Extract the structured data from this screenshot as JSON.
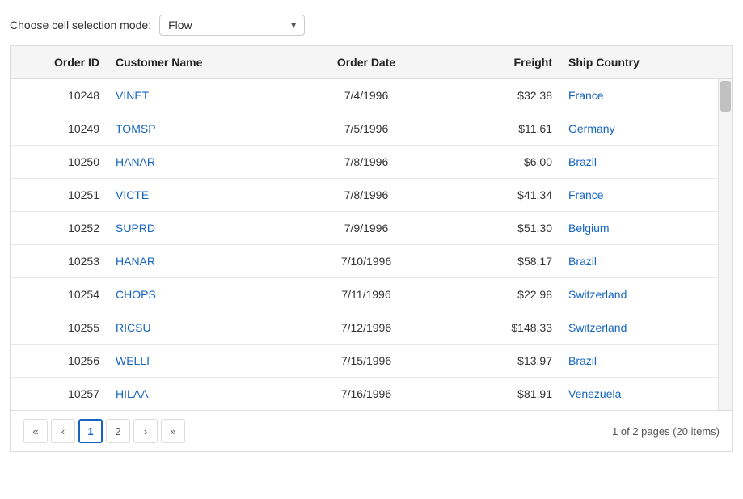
{
  "topbar": {
    "label": "Choose cell selection mode:",
    "dropdown_value": "Flow",
    "dropdown_arrow": "▾"
  },
  "table": {
    "columns": [
      {
        "key": "order_id",
        "label": "Order ID",
        "align": "right"
      },
      {
        "key": "customer",
        "label": "Customer Name",
        "align": "left"
      },
      {
        "key": "date",
        "label": "Order Date",
        "align": "center"
      },
      {
        "key": "freight",
        "label": "Freight",
        "align": "right"
      },
      {
        "key": "country",
        "label": "Ship Country",
        "align": "left"
      }
    ],
    "rows": [
      {
        "order_id": "10248",
        "customer": "VINET",
        "date": "7/4/1996",
        "freight": "$32.38",
        "country": "France"
      },
      {
        "order_id": "10249",
        "customer": "TOMSP",
        "date": "7/5/1996",
        "freight": "$11.61",
        "country": "Germany"
      },
      {
        "order_id": "10250",
        "customer": "HANAR",
        "date": "7/8/1996",
        "freight": "$6.00",
        "country": "Brazil"
      },
      {
        "order_id": "10251",
        "customer": "VICTE",
        "date": "7/8/1996",
        "freight": "$41.34",
        "country": "France"
      },
      {
        "order_id": "10252",
        "customer": "SUPRD",
        "date": "7/9/1996",
        "freight": "$51.30",
        "country": "Belgium"
      },
      {
        "order_id": "10253",
        "customer": "HANAR",
        "date": "7/10/1996",
        "freight": "$58.17",
        "country": "Brazil"
      },
      {
        "order_id": "10254",
        "customer": "CHOPS",
        "date": "7/11/1996",
        "freight": "$22.98",
        "country": "Switzerland"
      },
      {
        "order_id": "10255",
        "customer": "RICSU",
        "date": "7/12/1996",
        "freight": "$148.33",
        "country": "Switzerland"
      },
      {
        "order_id": "10256",
        "customer": "WELLI",
        "date": "7/15/1996",
        "freight": "$13.97",
        "country": "Brazil"
      },
      {
        "order_id": "10257",
        "customer": "HILAA",
        "date": "7/16/1996",
        "freight": "$81.91",
        "country": "Venezuela"
      }
    ]
  },
  "pagination": {
    "first_label": "«",
    "prev_label": "‹",
    "next_label": "›",
    "last_label": "»",
    "pages": [
      "1",
      "2"
    ],
    "active_page": "1",
    "summary": "1 of 2 pages (20 items)"
  }
}
